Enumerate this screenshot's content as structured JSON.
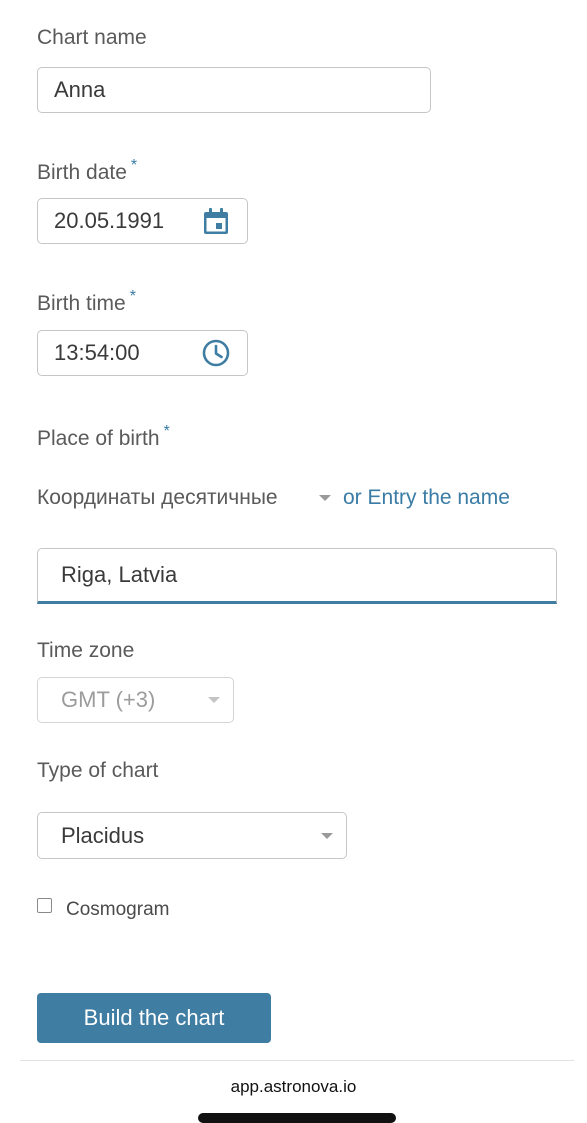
{
  "form": {
    "chart_name": {
      "label": "Chart name",
      "value": "Anna"
    },
    "birth_date": {
      "label": "Birth date",
      "required_mark": "*",
      "value": "20.05.1991",
      "icon": "calendar-icon"
    },
    "birth_time": {
      "label": "Birth time",
      "required_mark": "*",
      "value": "13:54:00",
      "icon": "clock-icon"
    },
    "place_of_birth": {
      "label": "Place of birth",
      "required_mark": "*",
      "coordinates_mode": "Координаты десятичные",
      "entry_link": "or Entry the name",
      "value": "Riga, Latvia"
    },
    "time_zone": {
      "label": "Time zone",
      "value": "GMT (+3)",
      "disabled": true
    },
    "chart_type": {
      "label": "Type of chart",
      "value": "Placidus"
    },
    "cosmogram": {
      "label": "Cosmogram",
      "checked": false
    },
    "submit_label": "Build the chart"
  },
  "browser": {
    "url": "app.astronova.io"
  },
  "colors": {
    "accent": "#3f7da3",
    "link": "#3a7ca5",
    "border": "#c6c6c6",
    "label_text": "#5a5a5a"
  }
}
